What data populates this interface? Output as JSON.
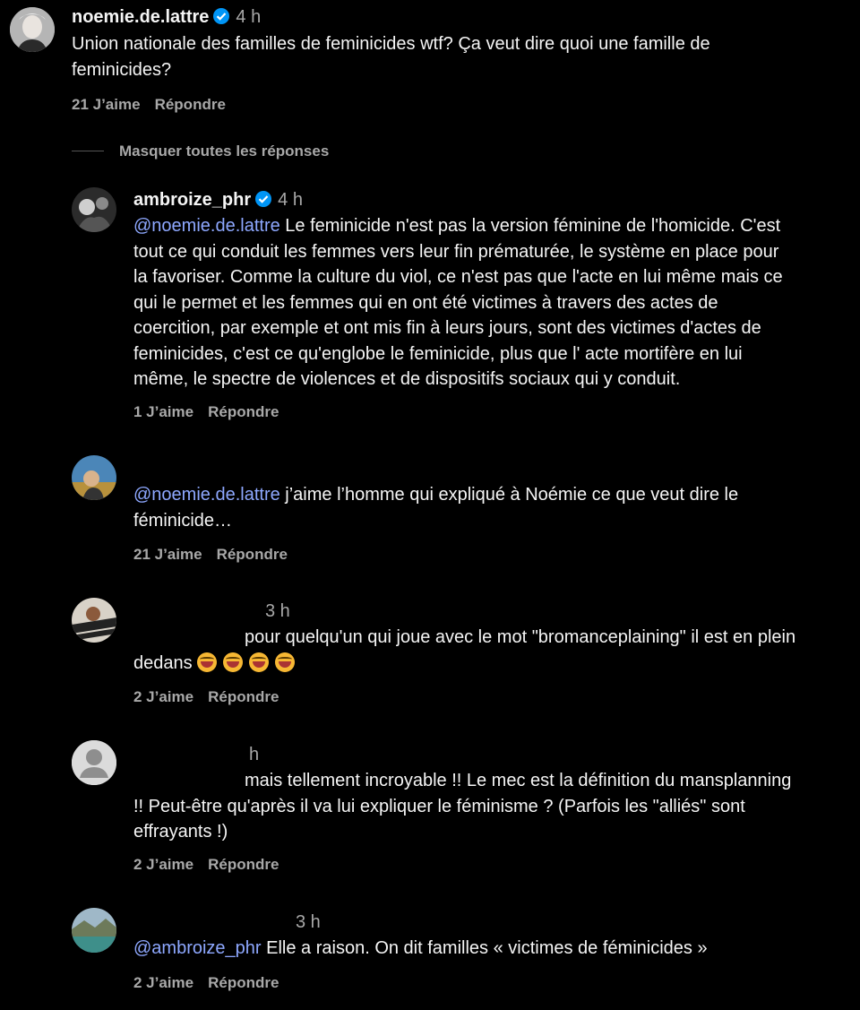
{
  "comments": [
    {
      "username": "noemie.de.lattre",
      "verified": true,
      "time": "4 h",
      "text": "Union nationale des familles de feminicides wtf? Ça veut dire quoi une famille de",
      "text2": "feminicides?",
      "likes": "21 J’aime",
      "reply": "Répondre"
    }
  ],
  "toggle_replies": "Masquer toutes les réponses",
  "replies": [
    {
      "username": "ambroize_phr",
      "verified": true,
      "time": "4 h",
      "mention": "@noemie.de.lattre",
      "lines": [
        " Le feminicide n'est pas la version féminine de l'homicide. C'est",
        "tout ce qui conduit les femmes vers leur fin prématurée, le système en place pour",
        "la favoriser. Comme la culture du viol, ce n'est pas que l'acte en lui même mais ce",
        "qui le permet et les femmes qui en ont été victimes à travers des actes de",
        "coercition, par exemple et ont mis fin à leurs jours, sont des victimes d'actes de",
        "feminicides, c'est ce qu'englobe le feminicide, plus que l' acte mortifère en lui",
        "même, le spectre de violences et de dispositifs sociaux qui y conduit."
      ],
      "likes": "1 J’aime",
      "reply": "Répondre"
    },
    {
      "mention": "@noemie.de.lattre",
      "line1": " j’aime l’homme qui expliqué à Noémie ce que veut dire le",
      "line2": "féminicide…",
      "likes": "21 J’aime",
      "reply": "Répondre"
    },
    {
      "time": "3 h",
      "line1": "pour quelqu'un qui joue avec le mot \"bromanceplaining\" il est en plein",
      "line2": "dedans",
      "emojis": [
        "grinning-face-emoji",
        "grinning-face-emoji",
        "grinning-face-emoji",
        "grinning-face-emoji"
      ],
      "likes": "2 J’aime",
      "reply": "Répondre"
    },
    {
      "time": "h",
      "line1": "mais tellement incroyable !! Le mec est la définition du mansplanning",
      "line2": "!! Peut-être qu'après il va lui expliquer le féminisme ? (Parfois les \"alliés\" sont",
      "line3": "effrayants !)",
      "likes": "2 J’aime",
      "reply": "Répondre"
    },
    {
      "time": "3 h",
      "mention": "@ambroize_phr",
      "line1": " Elle a raison. On dit familles « victimes de féminicides »",
      "likes": "2 J’aime",
      "reply": "Répondre"
    }
  ],
  "colors": {
    "background": "#000000",
    "text": "#f5f5f5",
    "muted": "#a8a8a8",
    "mention": "#8ea8ff",
    "verified": "#0095f6"
  }
}
